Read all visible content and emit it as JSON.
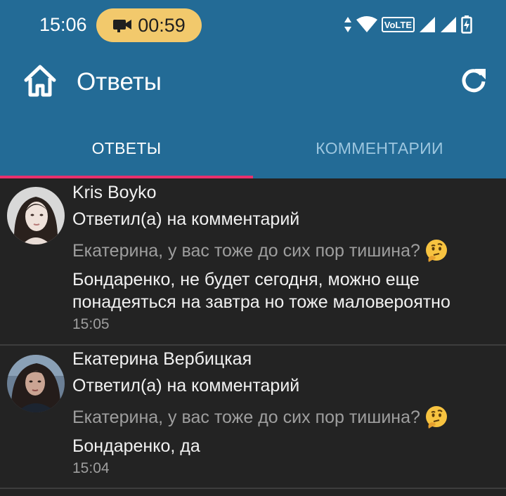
{
  "status_bar": {
    "time": "15:06",
    "recording_timer": "00:59",
    "icons": [
      "data-arrows-icon",
      "wifi-icon",
      "volte-icon",
      "signal-icon",
      "signal-icon",
      "battery-charging-icon"
    ],
    "volte_label": "VoLTE"
  },
  "app_bar": {
    "title": "Ответы",
    "home_icon": "home-icon",
    "refresh_icon": "refresh-icon"
  },
  "tabs": [
    {
      "label": "ОТВЕТЫ",
      "active": true
    },
    {
      "label": "КОММЕНТАРИИ",
      "active": false
    }
  ],
  "colors": {
    "header": "#236b96",
    "tab_indicator": "#e8306d",
    "background": "#232323",
    "pill": "#f2c96c"
  },
  "items": [
    {
      "name": "Kris Boyko",
      "action": "Ответил(а) на комментарий",
      "quote": "Екатерина, у вас тоже до сих пор тишина?",
      "quote_emoji": "thinking-face-emoji",
      "reply": "Бондаренко, не будет сегодня, можно еще понадеяться на завтра но тоже маловероятно",
      "time": "15:05"
    },
    {
      "name": "Екатерина Вербицкая",
      "action": "Ответил(а) на комментарий",
      "quote": "Екатерина, у вас тоже до сих пор тишина?",
      "quote_emoji": "thinking-face-emoji",
      "reply": "Бондаренко, да",
      "time": "15:04"
    }
  ]
}
